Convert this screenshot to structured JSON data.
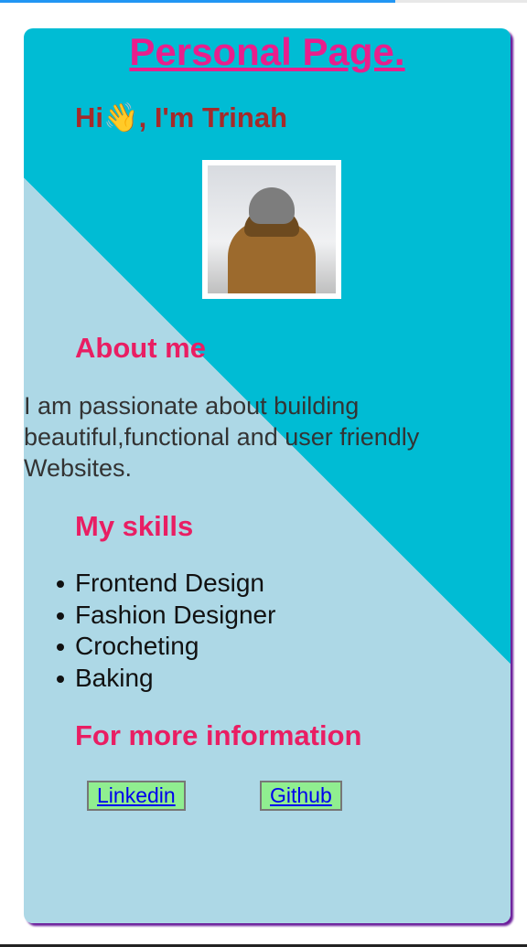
{
  "loading_progress": 0.75,
  "page": {
    "title": "Personal Page.",
    "greeting": "Hi👋, I'm Trinah",
    "photo_alt": "Profile photo of person wearing a beanie and brown hooded jacket",
    "about": {
      "heading": "About me",
      "text": "I am passionate about building beautiful,functional and user friendly Websites."
    },
    "skills": {
      "heading": "My skills",
      "items": [
        "Frontend Design",
        "Fashion Designer",
        "Crocheting",
        "Baking"
      ]
    },
    "contact": {
      "heading": "For more information",
      "links": [
        "Linkedin",
        "Github"
      ]
    }
  },
  "colors": {
    "card_light": "#add8e6",
    "card_cyan": "#00bcd4",
    "heading_pink": "#e91e63",
    "greeting_brown": "#a52a2a",
    "button_green": "#90ee90",
    "link_blue": "#0000ee",
    "progress_blue": "#2196f3"
  }
}
